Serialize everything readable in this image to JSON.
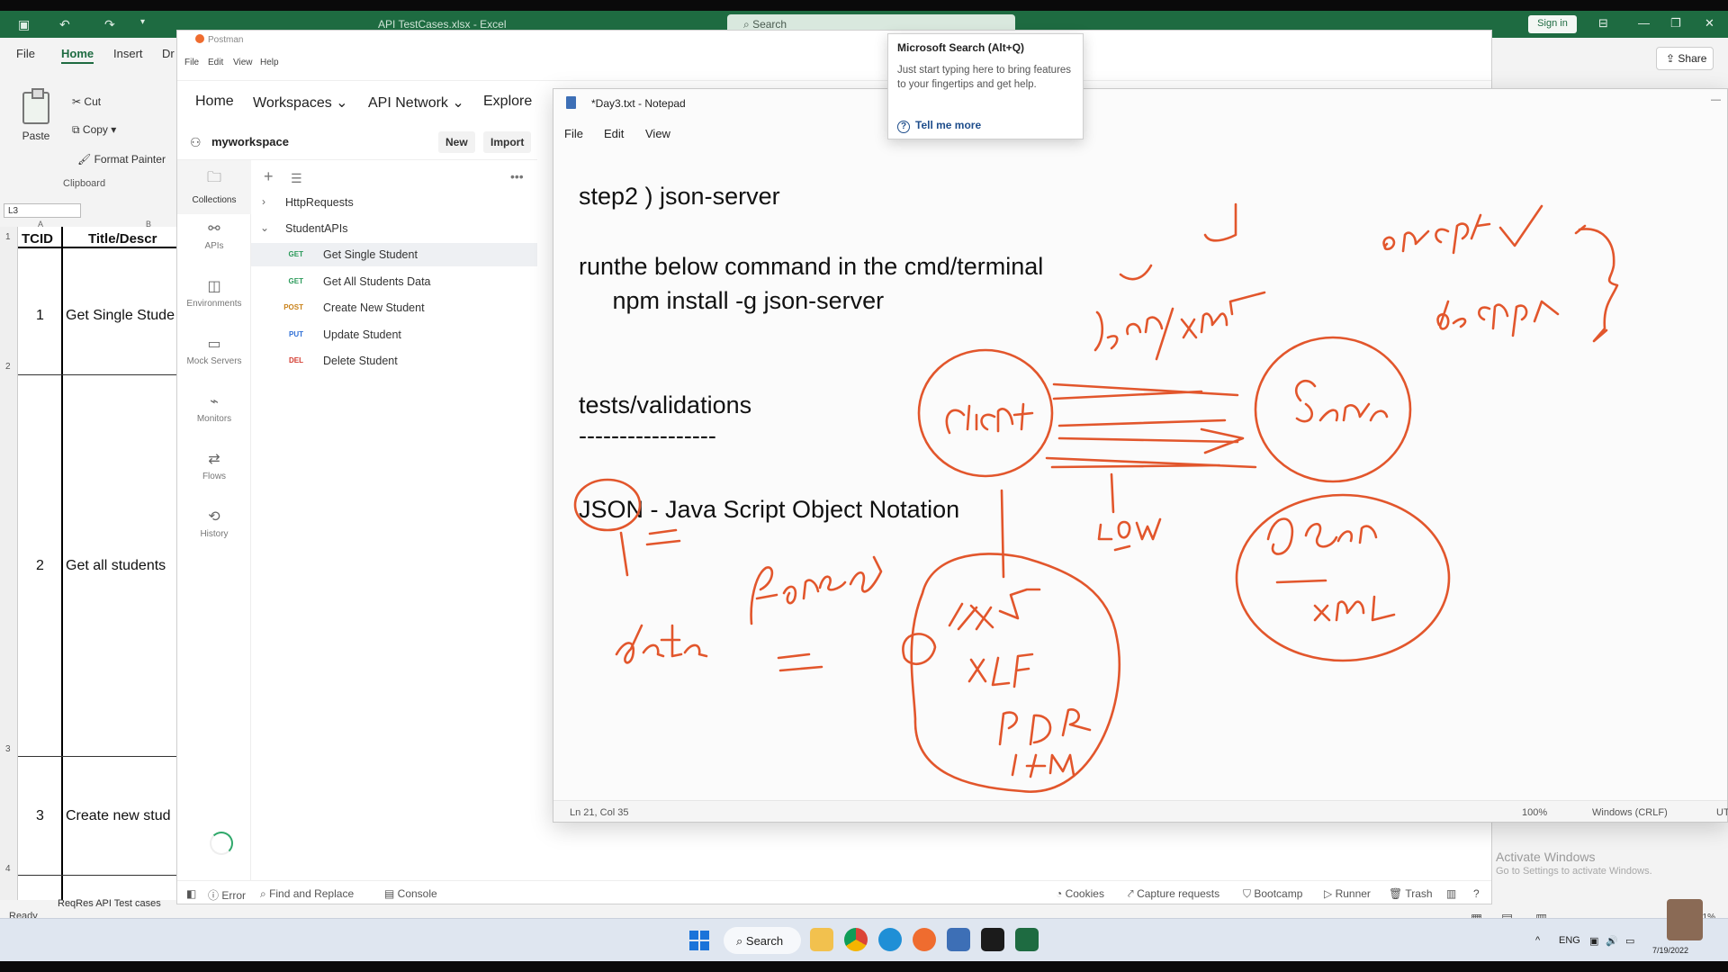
{
  "excel": {
    "title": "API TestCases.xlsx - Excel",
    "search_placeholder": "Search",
    "signin": "Sign in",
    "share": "Share",
    "menu": [
      "File",
      "Home",
      "Insert",
      "Dr"
    ],
    "ribbon": {
      "paste": "Paste",
      "cut": "Cut",
      "copy": "Copy",
      "format_painter": "Format Painter",
      "group": "Clipboard"
    },
    "name_box": "L3",
    "col_headers": [
      "A",
      "B"
    ],
    "header_row": {
      "a": "TCID",
      "b": "Title/Descr"
    },
    "rows": [
      {
        "row_num": "1",
        "id": "1",
        "title": "Get Single Stude"
      },
      {
        "row_num": "2",
        "id": "2",
        "title": "Get all students"
      },
      {
        "row_num": "3",
        "id": "3",
        "title": "Create new stud"
      }
    ],
    "row_numbers": [
      "1",
      "2",
      "3",
      "4"
    ],
    "sheet_tab": "ReqRes API Test cases",
    "status": "Ready",
    "zoom": "91%"
  },
  "postman": {
    "app_name": "Postman",
    "menus": [
      "File",
      "Edit",
      "View",
      "Help"
    ],
    "nav": [
      "Home",
      "Workspaces",
      "API Network",
      "Explore"
    ],
    "workspace": "myworkspace",
    "new_label": "New",
    "import_label": "Import",
    "rail": [
      {
        "label": "Collections",
        "icon": "collections-icon"
      },
      {
        "label": "APIs",
        "icon": "apis-icon"
      },
      {
        "label": "Environments",
        "icon": "environments-icon"
      },
      {
        "label": "Mock Servers",
        "icon": "mock-servers-icon"
      },
      {
        "label": "Monitors",
        "icon": "monitors-icon"
      },
      {
        "label": "Flows",
        "icon": "flows-icon"
      },
      {
        "label": "History",
        "icon": "history-icon"
      }
    ],
    "collections": [
      {
        "name": "HttpRequests"
      },
      {
        "name": "StudentAPIs"
      }
    ],
    "requests": [
      {
        "method": "GET",
        "name": "Get Single Student",
        "color": "#2b9a5a"
      },
      {
        "method": "GET",
        "name": "Get All Students Data",
        "color": "#2b9a5a"
      },
      {
        "method": "POST",
        "name": "Create New Student",
        "color": "#c9821a"
      },
      {
        "method": "PUT",
        "name": "Update Student",
        "color": "#2f6fd6"
      },
      {
        "method": "DEL",
        "name": "Delete Student",
        "color": "#d33a2f"
      }
    ],
    "status_bar": {
      "error": "Error",
      "find_replace": "Find and Replace",
      "console": "Console",
      "cookies": "Cookies",
      "capture": "Capture requests",
      "bootcamp": "Bootcamp",
      "runner": "Runner",
      "trash": "Trash"
    }
  },
  "notepad": {
    "title": "*Day3.txt - Notepad",
    "menu": [
      "File",
      "Edit",
      "View"
    ],
    "lines": [
      "step2 ) json-server",
      "",
      "runthe below command in the cmd/terminal",
      "     npm install -g json-server",
      "",
      "",
      "tests/validations",
      "-----------------",
      "",
      "JSON - Java Script Object Notation"
    ],
    "status": {
      "position": "Ln 21, Col 35",
      "zoom": "100%",
      "line_ending": "Windows (CRLF)",
      "encoding": "UT"
    },
    "ink_color": "#e2562c"
  },
  "tooltip": {
    "heading": "Microsoft Search (Alt+Q)",
    "body": "Just start typing here to bring features to your fingertips and get help.",
    "link": "Tell me more"
  },
  "watermark": {
    "title": "Activate Windows",
    "subtitle": "Go to Settings to activate Windows."
  },
  "taskbar": {
    "search": "Search",
    "lang": "ENG",
    "date": "7/19/2022"
  }
}
